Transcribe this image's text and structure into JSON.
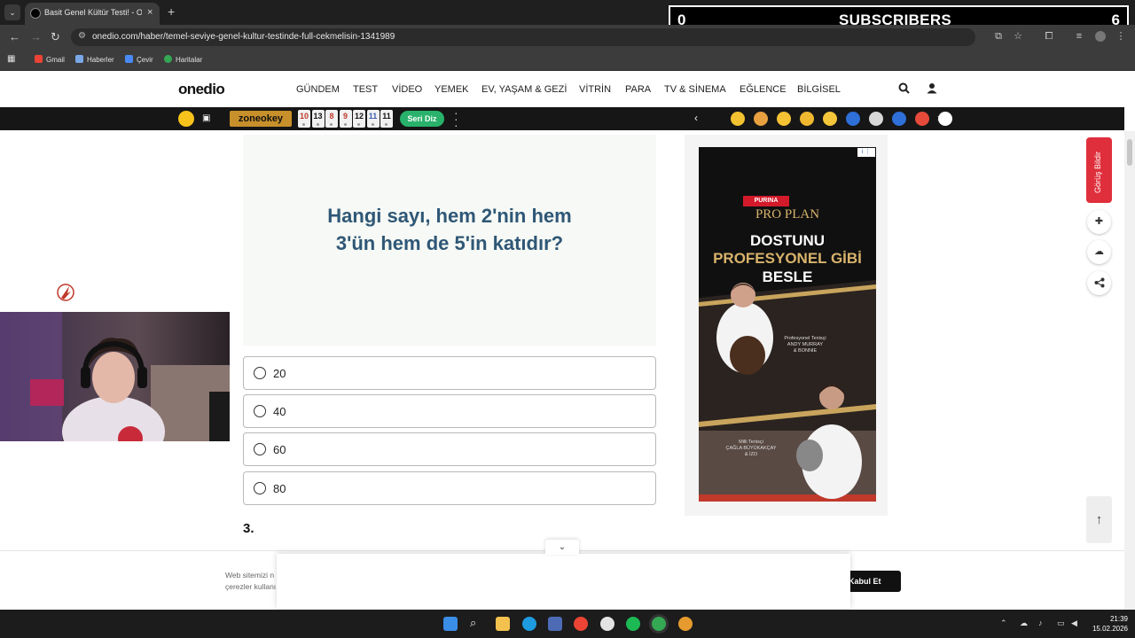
{
  "browser": {
    "tab_title": "Basit Genel Kültür Testi! - Onedi",
    "url": "onedio.com/haber/temel-seviye-genel-kultur-testinde-full-cekmelisin-1341989",
    "bookmarks": [
      "Gmail",
      "Haberler",
      "Çevir",
      "Haritalar"
    ]
  },
  "stream_overlay": {
    "left_count": "0",
    "label": "SUBSCRIBERS",
    "right_count": "6"
  },
  "site": {
    "logo": "onedio",
    "nav": [
      "GÜNDEM",
      "TEST",
      "VİDEO",
      "YEMEK",
      "EV, YAŞAM & GEZİ",
      "VİTRİN",
      "PARA",
      "TV & SİNEMA",
      "EĞLENCE",
      "BİLGİSEL"
    ],
    "strip": {
      "zone_label": "zoneokey",
      "tiles": [
        "10",
        "13",
        "8",
        "9",
        "12",
        "11",
        "11"
      ],
      "tile_colors": [
        "#c0392b",
        "#111111",
        "#c0392b",
        "#c0392b",
        "#111111",
        "#3a5dae",
        "#111111"
      ],
      "seri_diz": "Seri Diz",
      "emoji_colors": [
        "#f2c230",
        "#e8a040",
        "#f4c233",
        "#f0b830",
        "#f5c63a",
        "#2e6fd8",
        "#d8d8d8",
        "#2e6fd8",
        "#e64a3b",
        "#ffffff"
      ]
    }
  },
  "quiz": {
    "question_line1": "Hangi sayı, hem 2'nin hem",
    "question_line2": "3'ün hem de 5'in katıdır?",
    "options": [
      "20",
      "40",
      "60",
      "80"
    ],
    "next_number": "3."
  },
  "ad": {
    "badge": "i ⋮",
    "brand": "PURINA",
    "product": "PRO PLAN",
    "line1": "DOSTUNU",
    "line2": "PROFESYONEL GİBİ",
    "line3": "BESLE",
    "caption1": "Profesyonel Tenisçi\nANDY MURRAY\n& BONNIE",
    "caption2": "Milli Tenisçi\nÇAĞLA BÜYÜKAKÇAY\n& İZO",
    "colors": {
      "gold": "#d8b36b",
      "white": "#ffffff"
    }
  },
  "sidebar": {
    "feedback_label": "Görüş Bildir"
  },
  "cookie": {
    "text_line1": "Web sitemizi n",
    "text_line2": "çerezler kullanı",
    "button": "Kabul Et"
  },
  "taskbar": {
    "time": "21:39",
    "date": "15.02.2026"
  },
  "colors": {
    "accent_red": "#e02f3c",
    "question_blue": "#2f5776",
    "seri_green": "#29b26b"
  }
}
